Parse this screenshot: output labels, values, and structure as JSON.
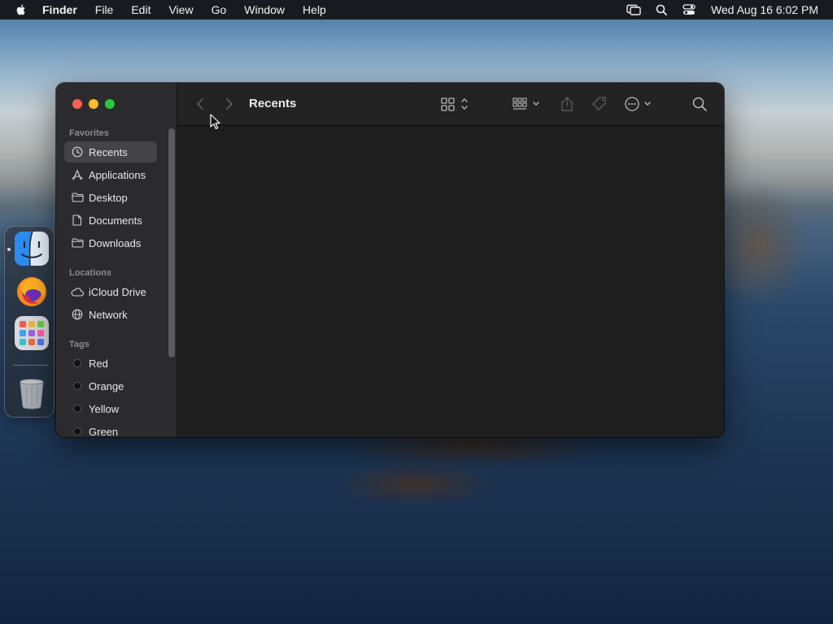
{
  "menubar": {
    "app_name": "Finder",
    "menus": [
      "File",
      "Edit",
      "View",
      "Go",
      "Window",
      "Help"
    ],
    "clock": "Wed Aug 16  6:02 PM"
  },
  "window": {
    "title": "Recents",
    "sidebar": {
      "favorites_title": "Favorites",
      "favorites": [
        {
          "label": "Recents",
          "icon": "clock-icon",
          "selected": true
        },
        {
          "label": "Applications",
          "icon": "applications-icon"
        },
        {
          "label": "Desktop",
          "icon": "folder-icon"
        },
        {
          "label": "Documents",
          "icon": "document-icon"
        },
        {
          "label": "Downloads",
          "icon": "folder-icon"
        }
      ],
      "locations_title": "Locations",
      "locations": [
        {
          "label": "iCloud Drive",
          "icon": "cloud-icon"
        },
        {
          "label": "Network",
          "icon": "globe-icon"
        }
      ],
      "tags_title": "Tags",
      "tags": [
        {
          "label": "Red"
        },
        {
          "label": "Orange"
        },
        {
          "label": "Yellow"
        },
        {
          "label": "Green"
        }
      ]
    }
  },
  "dock": {
    "apps": [
      {
        "name": "Finder",
        "icon": "finder-icon",
        "running": true
      },
      {
        "name": "Firefox",
        "icon": "firefox-icon"
      },
      {
        "name": "Launchpad",
        "icon": "launchpad-icon"
      },
      {
        "name": "Trash",
        "icon": "trash-icon"
      }
    ]
  },
  "colors": {
    "close": "#ff5f57",
    "minimize": "#febc2e",
    "maximize": "#28c840",
    "sidebar_bg": "#2b2b2d",
    "content_bg": "#1e1e1e"
  }
}
